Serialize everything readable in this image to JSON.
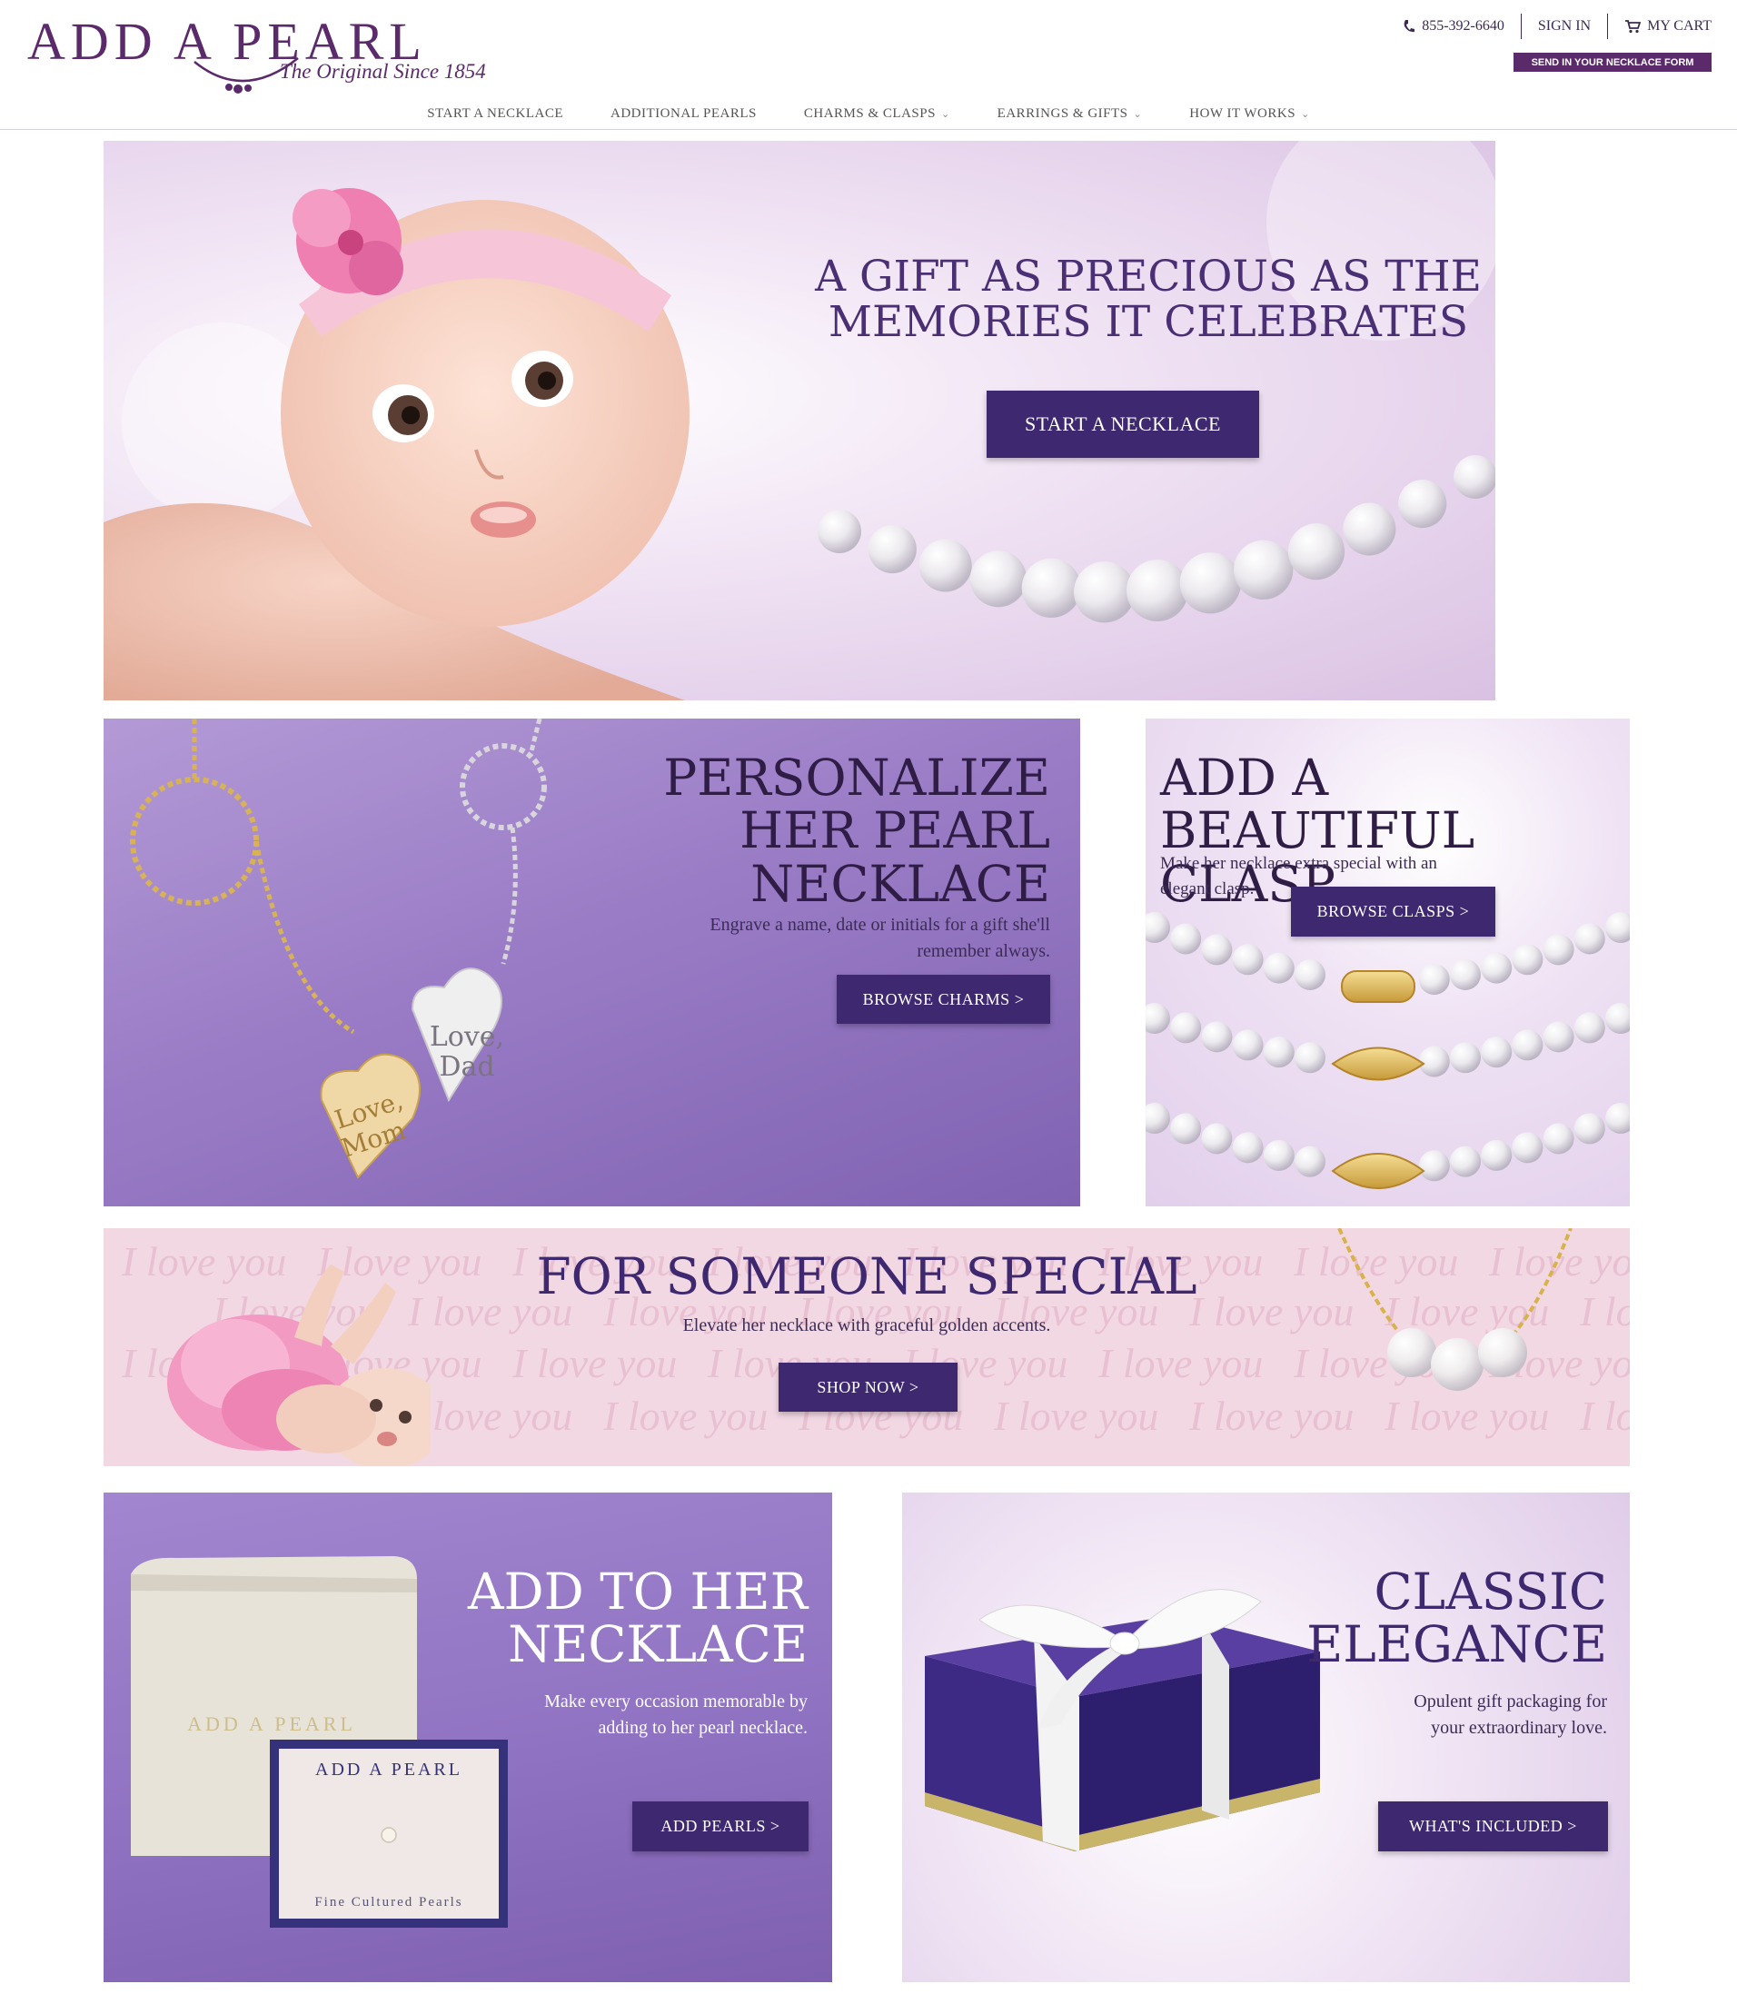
{
  "brand": {
    "name": "ADD A PEARL",
    "tagline": "The Original Since 1854"
  },
  "utility": {
    "phone": "855-392-6640",
    "sign_in": "SIGN IN",
    "cart": "MY CART",
    "send_form": "SEND IN YOUR NECKLACE FORM"
  },
  "nav": {
    "items": [
      {
        "label": "START A NECKLACE"
      },
      {
        "label": "ADDITIONAL PEARLS"
      },
      {
        "label": "CHARMS & CLASPS"
      },
      {
        "label": "EARRINGS & GIFTS"
      },
      {
        "label": "HOW IT WORKS"
      }
    ]
  },
  "hero": {
    "headline_1": "A GIFT AS PRECIOUS AS THE",
    "headline_2": "MEMORIES IT CELEBRATES",
    "button": "START A  NECKLACE"
  },
  "personalize": {
    "headline_1": "PERSONALIZE",
    "headline_2": "HER PEARL",
    "headline_3": "NECKLACE",
    "sub_1": "Engrave a name, date or initials for a gift she'll",
    "sub_2": "remember always.",
    "button": "BROWSE CHARMS >",
    "charm_1_line_1": "Love,",
    "charm_1_line_2": "Mom",
    "charm_2_line_1": "Love,",
    "charm_2_line_2": "Dad"
  },
  "clasp": {
    "headline_1": "ADD A BEAUTIFUL",
    "headline_2": "CLASP",
    "sub_1": "Make her necklace extra special with an",
    "sub_2": "elegant clasp.",
    "button": "BROWSE CLASPS >"
  },
  "special": {
    "headline": "FOR SOMEONE SPECIAL",
    "sub": "Elevate her necklace with graceful golden accents.",
    "button": "SHOP NOW >",
    "background_text": "I love you"
  },
  "add_to_her": {
    "headline_1": "ADD TO HER",
    "headline_2": "NECKLACE",
    "sub_1": "Make every occasion memorable by",
    "sub_2": "adding to her pearl necklace.",
    "button": "ADD PEARLS >",
    "box_brand": "ADD A PEARL",
    "card_brand": "ADD A PEARL",
    "card_caption": "Fine Cultured Pearls"
  },
  "classic": {
    "headline_1": "CLASSIC",
    "headline_2": "ELEGANCE",
    "sub_1": "Opulent gift packaging for",
    "sub_2": "your extraordinary love.",
    "button": "WHAT'S INCLUDED >"
  },
  "colors": {
    "brand_purple": "#5b2a6b",
    "button_purple": "#3e2870",
    "heading_purple": "#4a2f74",
    "pink_panel": "#f2d8e3"
  }
}
